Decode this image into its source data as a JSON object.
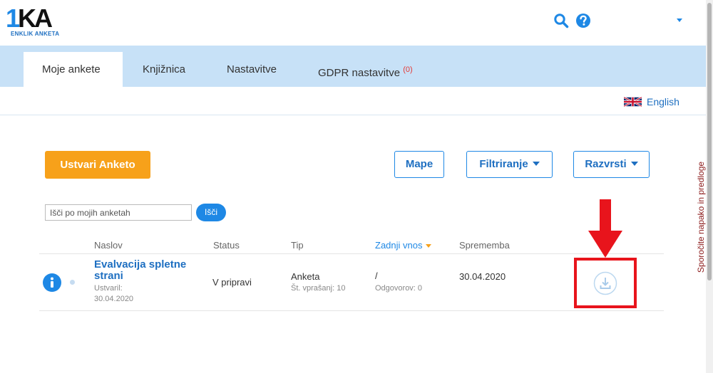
{
  "header": {
    "logo_main_1": "1",
    "logo_main_2": "KA",
    "logo_sub": "ENKLIK ANKETA",
    "icons": [
      "search-icon",
      "help-icon",
      "chevron-down-icon"
    ],
    "accent_color": "#1e88e5"
  },
  "tabs": [
    {
      "label": "Moje ankete",
      "active": true
    },
    {
      "label": "Knjižnica",
      "active": false
    },
    {
      "label": "Nastavitve",
      "active": false
    },
    {
      "label": "GDPR nastavitve",
      "badge": "(0)",
      "active": false
    }
  ],
  "language": {
    "label": "English",
    "flag_icon": "uk-flag-icon"
  },
  "actions": {
    "create": "Ustvari Anketo",
    "folders": "Mape",
    "filter": "Filtriranje",
    "sort": "Razvrsti",
    "create_color": "#f7a11a"
  },
  "search": {
    "placeholder": "Išči po mojih anketah",
    "button": "Išči"
  },
  "table": {
    "columns": [
      "Naslov",
      "Status",
      "Tip",
      "Zadnji vnos",
      "Sprememba"
    ],
    "sorted_column": "Zadnji vnos",
    "rows": [
      {
        "title": "Evalvacija spletne strani",
        "created_label": "Ustvaril:",
        "created_date": "30.04.2020",
        "status": "V pripravi",
        "type": "Anketa",
        "question_count": "Št. vprašanj: 10",
        "last_entry": "/",
        "answers": "Odgovorov: 0",
        "changed": "30.04.2020",
        "row_icons": [
          "info-icon",
          "download-icon"
        ]
      }
    ]
  },
  "side_tab": {
    "label": "Sporočite napako in predloge"
  },
  "annotation": {
    "highlight_color": "#e8141c"
  }
}
